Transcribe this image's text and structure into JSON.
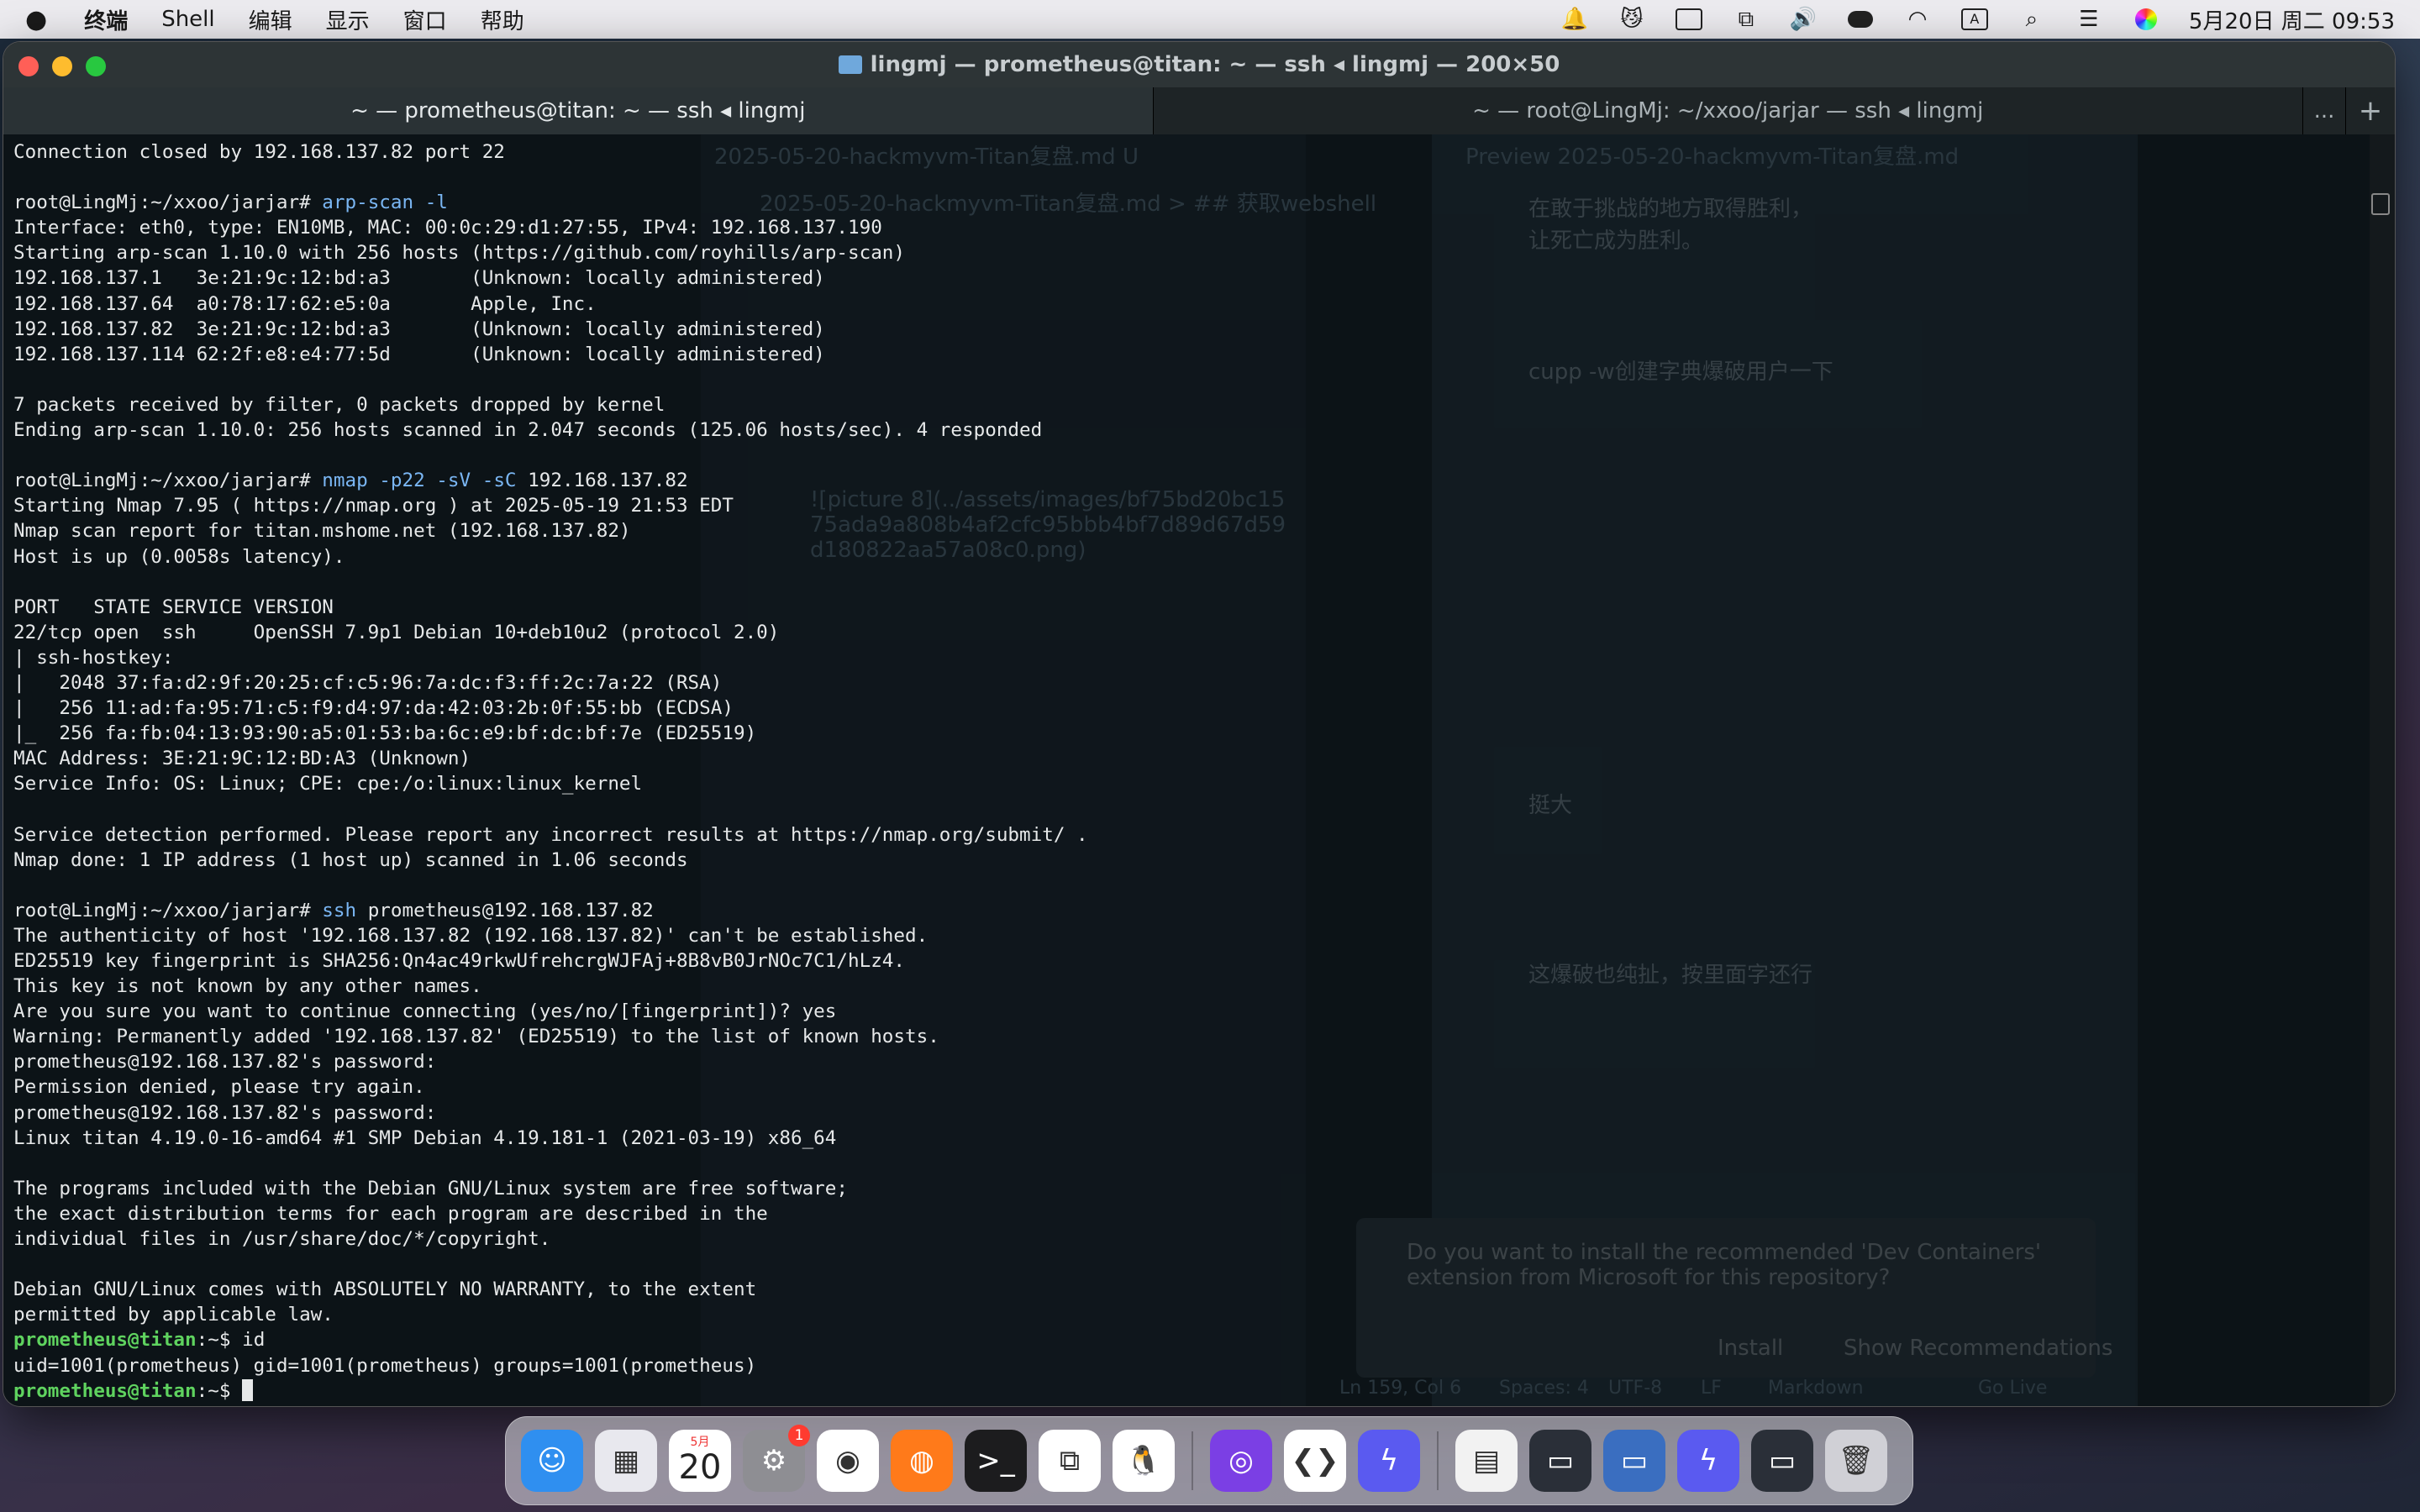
{
  "menubar": {
    "apple": "",
    "items": [
      "终端",
      "Shell",
      "编辑",
      "显示",
      "窗口",
      "帮助"
    ],
    "input_method": "A",
    "clock": "5月20日 周二 09:53"
  },
  "window": {
    "title": "lingmj — prometheus@titan: ~ — ssh ◂ lingmj — 200×50",
    "tabs": [
      {
        "label": "~ — prometheus@titan: ~ — ssh ◂ lingmj",
        "active": true
      },
      {
        "label": "~ — root@LingMj: ~/xxoo/jarjar — ssh ◂ lingmj",
        "active": false
      }
    ],
    "tab_more": "...",
    "tab_add": "+"
  },
  "terminal": {
    "lines": [
      {
        "out": "Connection closed by 192.168.137.82 port 22"
      },
      {
        "out": ""
      },
      {
        "prompt": "root@LingMj:~/xxoo/jarjar# ",
        "cmd": "arp-scan -l"
      },
      {
        "out": "Interface: eth0, type: EN10MB, MAC: 00:0c:29:d1:27:55, IPv4: 192.168.137.190"
      },
      {
        "out": "Starting arp-scan 1.10.0 with 256 hosts (https://github.com/royhills/arp-scan)"
      },
      {
        "out": "192.168.137.1   3e:21:9c:12:bd:a3       (Unknown: locally administered)"
      },
      {
        "out": "192.168.137.64  a0:78:17:62:e5:0a       Apple, Inc."
      },
      {
        "out": "192.168.137.82  3e:21:9c:12:bd:a3       (Unknown: locally administered)"
      },
      {
        "out": "192.168.137.114 62:2f:e8:e4:77:5d       (Unknown: locally administered)"
      },
      {
        "out": ""
      },
      {
        "out": "7 packets received by filter, 0 packets dropped by kernel"
      },
      {
        "out": "Ending arp-scan 1.10.0: 256 hosts scanned in 2.047 seconds (125.06 hosts/sec). 4 responded"
      },
      {
        "out": ""
      },
      {
        "prompt": "root@LingMj:~/xxoo/jarjar# ",
        "cmd": "nmap -p22 -sV -sC ",
        "arg": "192.168.137.82"
      },
      {
        "out": "Starting Nmap 7.95 ( https://nmap.org ) at 2025-05-19 21:53 EDT"
      },
      {
        "out": "Nmap scan report for titan.mshome.net (192.168.137.82)"
      },
      {
        "out": "Host is up (0.0058s latency)."
      },
      {
        "out": ""
      },
      {
        "out": "PORT   STATE SERVICE VERSION"
      },
      {
        "out": "22/tcp open  ssh     OpenSSH 7.9p1 Debian 10+deb10u2 (protocol 2.0)"
      },
      {
        "out": "| ssh-hostkey:"
      },
      {
        "out": "|   2048 37:fa:d2:9f:20:25:cf:c5:96:7a:dc:f3:ff:2c:7a:22 (RSA)"
      },
      {
        "out": "|   256 11:ad:fa:95:71:c5:f9:d4:97:da:42:03:2b:0f:55:bb (ECDSA)"
      },
      {
        "out": "|_  256 fa:fb:04:13:93:90:a5:01:53:ba:6c:e9:bf:dc:bf:7e (ED25519)"
      },
      {
        "out": "MAC Address: 3E:21:9C:12:BD:A3 (Unknown)"
      },
      {
        "out": "Service Info: OS: Linux; CPE: cpe:/o:linux:linux_kernel"
      },
      {
        "out": ""
      },
      {
        "out": "Service detection performed. Please report any incorrect results at https://nmap.org/submit/ ."
      },
      {
        "out": "Nmap done: 1 IP address (1 host up) scanned in 1.06 seconds"
      },
      {
        "out": ""
      },
      {
        "prompt": "root@LingMj:~/xxoo/jarjar# ",
        "cmd": "ssh ",
        "arg": "prometheus@",
        "arg2": "192.168.137.82"
      },
      {
        "out": "The authenticity of host '192.168.137.82 (192.168.137.82)' can't be established."
      },
      {
        "out": "ED25519 key fingerprint is SHA256:Qn4ac49rkwUfrehcrgWJFAj+8B8vB0JrNOc7C1/hLz4."
      },
      {
        "out": "This key is not known by any other names."
      },
      {
        "out": "Are you sure you want to continue connecting (yes/no/[fingerprint])? yes"
      },
      {
        "out": "Warning: Permanently added '192.168.137.82' (ED25519) to the list of known hosts."
      },
      {
        "out": "prometheus@192.168.137.82's password:"
      },
      {
        "out": "Permission denied, please try again."
      },
      {
        "out": "prometheus@192.168.137.82's password:"
      },
      {
        "out": "Linux titan 4.19.0-16-amd64 #1 SMP Debian 4.19.181-1 (2021-03-19) x86_64"
      },
      {
        "out": ""
      },
      {
        "out": "The programs included with the Debian GNU/Linux system are free software;"
      },
      {
        "out": "the exact distribution terms for each program are described in the"
      },
      {
        "out": "individual files in /usr/share/doc/*/copyright."
      },
      {
        "out": ""
      },
      {
        "out": "Debian GNU/Linux comes with ABSOLUTELY NO WARRANTY, to the extent"
      },
      {
        "out": "permitted by applicable law."
      },
      {
        "user": "prometheus@titan",
        "path": ":~",
        "sign": "$ ",
        "cmd_plain": "id"
      },
      {
        "out": "uid=1001(prometheus) gid=1001(prometheus) groups=1001(prometheus)"
      },
      {
        "user": "prometheus@titan",
        "path": ":~",
        "sign": "$ ",
        "cursor": true
      }
    ]
  },
  "background_window": {
    "editor_tab": "2025-05-20-hackmyvm-Titan复盘.md U",
    "preview_tab": "Preview 2025-05-20-hackmyvm-Titan复盘.md",
    "breadcrumb": "2025-05-20-hackmyvm-Titan复盘.md > ## 获取webshell",
    "preview_quote_1": "在敢于挑战的地方取得胜利，",
    "preview_quote_2": "让死亡成为胜利。",
    "preview_heading_1": "cupp -w创建字典爆破用户一下",
    "preview_heading_2": "挺大",
    "preview_heading_3": "这爆破也纯扯，按里面字还行",
    "editor_link": "![picture 8](../assets/images/bf75bd20bc1575ada9a808b4af2cfc95bbb4bf7d89d67d59d180822aa57a08c0.png)",
    "notification_text": "Do you want to install the recommended 'Dev Containers' extension from Microsoft for this repository?",
    "notification_install": "Install",
    "notification_show": "Show Recommendations",
    "status_cursor": "Ln 159, Col 6",
    "status_spaces": "Spaces: 4",
    "status_encoding": "UTF-8",
    "status_eol": "LF",
    "status_lang": "Markdown",
    "status_live": "Go Live"
  },
  "dock": {
    "apps": [
      {
        "name": "finder",
        "color": "#2f8ff0",
        "glyph": "☺"
      },
      {
        "name": "launchpad",
        "color": "#e8e8ee",
        "glyph": "▦"
      },
      {
        "name": "calendar",
        "color": "#ffffff",
        "month": "5月",
        "day": "20"
      },
      {
        "name": "system-settings",
        "color": "#8e8e93",
        "glyph": "⚙",
        "badge": "1"
      },
      {
        "name": "chrome",
        "color": "#ffffff",
        "glyph": "◉"
      },
      {
        "name": "firefox",
        "color": "#ff7a1a",
        "glyph": "◍"
      },
      {
        "name": "terminal",
        "color": "#1c1c1e",
        "glyph": ">_"
      },
      {
        "name": "remote-desktop",
        "color": "#ffffff",
        "glyph": "⧉"
      },
      {
        "name": "qq",
        "color": "#ffffff",
        "glyph": "🐧"
      },
      {
        "name": "github-desktop",
        "color": "#7b3fe4",
        "glyph": "◎"
      },
      {
        "name": "vscode",
        "color": "#ffffff",
        "glyph": "❮❯"
      },
      {
        "name": "lightning-app",
        "color": "#5a5af0",
        "glyph": "ϟ"
      },
      {
        "name": "preview-doc",
        "color": "#f2f2f2",
        "glyph": "▤"
      },
      {
        "name": "window-thumb-1",
        "color": "#2a2f38",
        "glyph": "▭"
      },
      {
        "name": "window-thumb-2",
        "color": "#3a6ec0",
        "glyph": "▭"
      },
      {
        "name": "window-thumb-3",
        "color": "#5a5af0",
        "glyph": "ϟ"
      },
      {
        "name": "window-thumb-4",
        "color": "#2a2f38",
        "glyph": "▭"
      },
      {
        "name": "trash",
        "color": "#d0d0d6",
        "glyph": "🗑"
      }
    ]
  }
}
